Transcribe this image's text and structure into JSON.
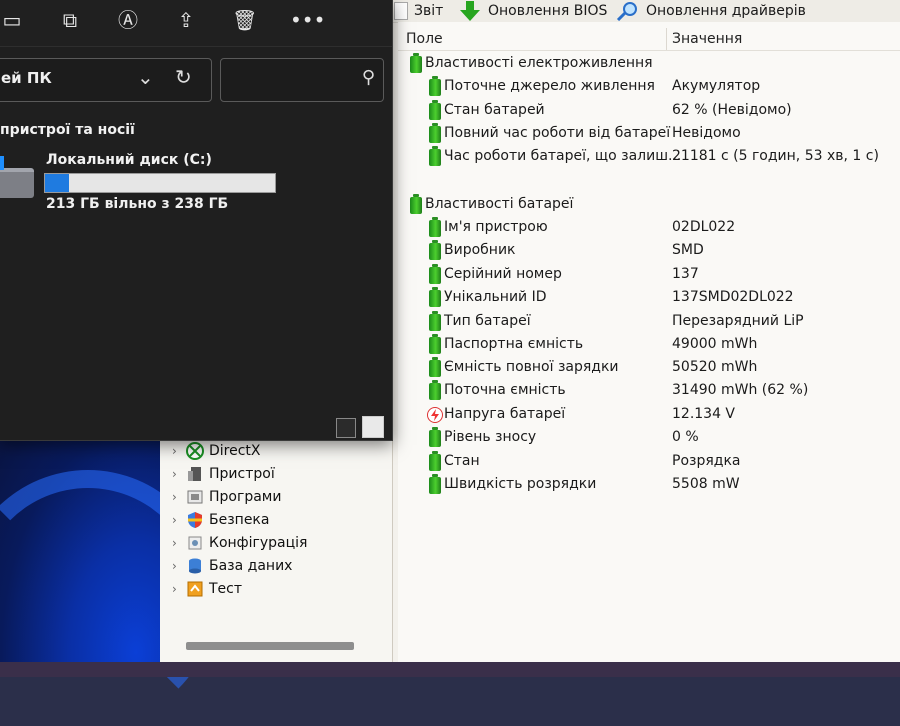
{
  "explorer": {
    "address": "ей ПК",
    "section_title": "пристрої та носії",
    "drive": {
      "name": "Локальний диск (C:)",
      "free_text": "213 ГБ вільно з 238 ГБ",
      "used_fraction": 0.105,
      "fill_color": "#1f7be0"
    },
    "toolbar_icons": [
      "folder-icon",
      "copy-icon",
      "rename-icon",
      "share-icon",
      "delete-icon",
      "more-icon"
    ]
  },
  "aida_toolbar": {
    "report": "Звіт",
    "bios_update": "Оновлення BIOS",
    "driver_update": "Оновлення драйверів"
  },
  "tree": {
    "items": [
      {
        "label": "DirectX",
        "icon": "xbox-icon"
      },
      {
        "label": "Пристрої",
        "icon": "devices-icon"
      },
      {
        "label": "Програми",
        "icon": "programs-icon"
      },
      {
        "label": "Безпека",
        "icon": "shield-icon"
      },
      {
        "label": "Конфігурація",
        "icon": "config-icon"
      },
      {
        "label": "База даних",
        "icon": "database-icon"
      },
      {
        "label": "Тест",
        "icon": "test-icon"
      }
    ]
  },
  "grid": {
    "col_field": "Поле",
    "col_value": "Значення",
    "power_group": "Властивості електроживлення",
    "power_rows": [
      {
        "label": "Поточне джерело живлення",
        "value": "Акумулятор"
      },
      {
        "label": "Стан батарей",
        "value": "62 % (Невідомо)"
      },
      {
        "label": "Повний час роботи від батареї",
        "value": "Невідомо"
      },
      {
        "label": "Час роботи батареї, що залиш...",
        "value": "21181 с (5 годин, 53 хв, 1 с)"
      }
    ],
    "battery_group": "Властивості батареї",
    "battery_rows": [
      {
        "label": "Ім'я пристрою",
        "value": "02DL022",
        "icon": "battery"
      },
      {
        "label": "Виробник",
        "value": "SMD",
        "icon": "battery"
      },
      {
        "label": "Серійний номер",
        "value": "137",
        "icon": "battery"
      },
      {
        "label": "Унікальний ID",
        "value": "137SMD02DL022",
        "icon": "battery"
      },
      {
        "label": "Тип батареї",
        "value": "Перезарядний LiP",
        "icon": "battery"
      },
      {
        "label": "Паспортна ємність",
        "value": "49000 mWh",
        "icon": "battery"
      },
      {
        "label": "Ємність повної зарядки",
        "value": "50520 mWh",
        "icon": "battery"
      },
      {
        "label": "Поточна ємність",
        "value": "31490 mWh  (62 %)",
        "icon": "battery"
      },
      {
        "label": "Напруга батареї",
        "value": "12.134 V",
        "icon": "bolt"
      },
      {
        "label": "Рівень зносу",
        "value": "0 %",
        "icon": "battery"
      },
      {
        "label": "Стан",
        "value": "Розрядка",
        "icon": "battery"
      },
      {
        "label": "Швидкість розрядки",
        "value": "5508 mW",
        "icon": "battery"
      }
    ]
  }
}
